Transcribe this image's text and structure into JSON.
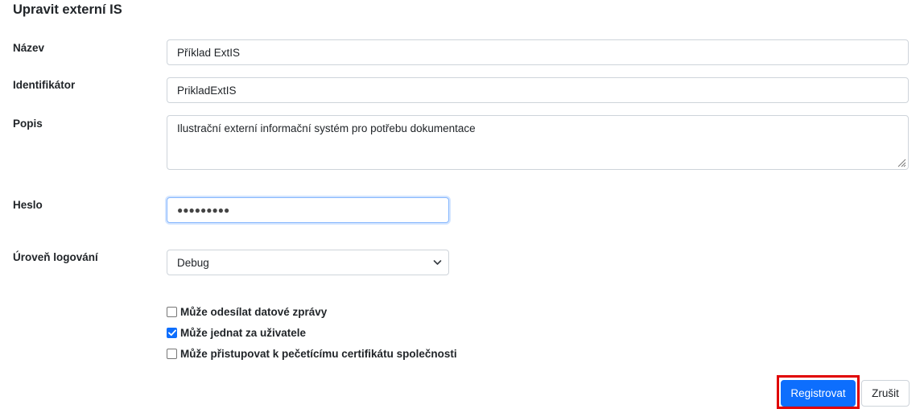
{
  "form": {
    "title": "Upravit externí IS",
    "name": {
      "label": "Název",
      "value": "Příklad ExtIS"
    },
    "identifier": {
      "label": "Identifikátor",
      "value": "PrikladExtIS"
    },
    "description": {
      "label": "Popis",
      "value": "Ilustrační externí informační systém pro potřebu dokumentace"
    },
    "password": {
      "label": "Heslo",
      "masked": "●●●●●●●●●"
    },
    "log_level": {
      "label": "Úroveň logování",
      "selected": "Debug"
    },
    "checkboxes": [
      {
        "label": "Může odesílat datové zprávy",
        "checked": false
      },
      {
        "label": "Může jednat za uživatele",
        "checked": true
      },
      {
        "label": "Může přistupovat k pečetícímu certifikátu společnosti",
        "checked": false
      }
    ],
    "buttons": {
      "submit": "Registrovat",
      "cancel": "Zrušit"
    }
  },
  "colors": {
    "primary": "#0d6efd",
    "highlight": "#e00000",
    "border": "#ced4da"
  },
  "icons": {
    "select": "chevron-down-icon",
    "checkbox": "checkmark-icon",
    "textarea": "resize-grip-icon"
  }
}
